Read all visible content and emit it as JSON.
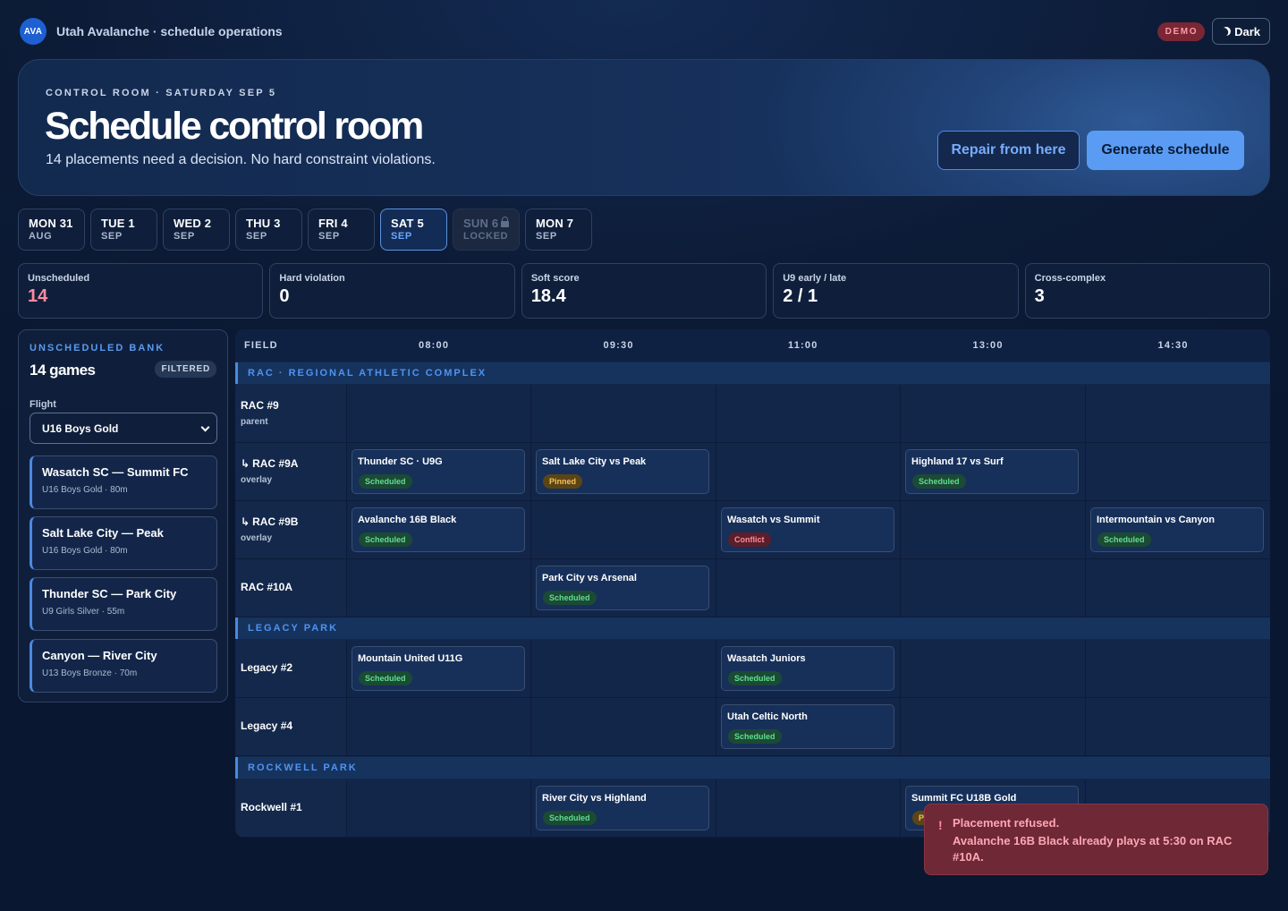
{
  "app": {
    "logo": "AVA",
    "title": "Utah Avalanche · schedule operations",
    "demo_badge": "DEMO",
    "theme_label": "Dark"
  },
  "hero": {
    "eyebrow": "CONTROL ROOM · SATURDAY SEP 5",
    "title": "Schedule control room",
    "subtitle": "14 placements need a decision. No hard constraint violations.",
    "repair_label": "Repair from here",
    "generate_label": "Generate schedule"
  },
  "days": [
    {
      "day": "MON 31",
      "month": "AUG",
      "state": "normal"
    },
    {
      "day": "TUE 1",
      "month": "SEP",
      "state": "normal"
    },
    {
      "day": "WED 2",
      "month": "SEP",
      "state": "normal"
    },
    {
      "day": "THU 3",
      "month": "SEP",
      "state": "normal"
    },
    {
      "day": "FRI 4",
      "month": "SEP",
      "state": "normal"
    },
    {
      "day": "SAT 5",
      "month": "SEP",
      "state": "active"
    },
    {
      "day": "SUN 6",
      "month": "LOCKED",
      "state": "locked"
    },
    {
      "day": "MON 7",
      "month": "SEP",
      "state": "normal"
    }
  ],
  "stats": [
    {
      "label": "Unscheduled",
      "value": "14",
      "accent": "#ff8aa0"
    },
    {
      "label": "Hard violation",
      "value": "0"
    },
    {
      "label": "Soft score",
      "value": "18.4"
    },
    {
      "label": "U9 early / late",
      "value": "2 / 1"
    },
    {
      "label": "Cross-complex",
      "value": "3"
    }
  ],
  "bank": {
    "eyebrow": "UNSCHEDULED BANK",
    "count": "14 games",
    "filter_badge": "FILTERED",
    "flight_label": "Flight",
    "flight_value": "U16 Boys Gold",
    "cards": [
      {
        "title": "Wasatch SC — Summit FC",
        "meta": "U16 Boys Gold · 80m"
      },
      {
        "title": "Salt Lake City — Peak",
        "meta": "U16 Boys Gold · 80m"
      },
      {
        "title": "Thunder SC — Park City",
        "meta": "U9 Girls Silver · 55m"
      },
      {
        "title": "Canyon — River City",
        "meta": "U13 Boys Bronze · 70m"
      }
    ]
  },
  "grid": {
    "field_header": "FIELD",
    "times": [
      "08:00",
      "09:30",
      "11:00",
      "13:00",
      "14:30"
    ],
    "sections": [
      {
        "name": "RAC · REGIONAL ATHLETIC COMPLEX"
      },
      {
        "name": "LEGACY PARK"
      },
      {
        "name": "ROCKWELL PARK"
      }
    ],
    "rows": [
      {
        "name": "RAC #9",
        "sub": "parent"
      },
      {
        "name": "RAC #9A",
        "sub": "overlay",
        "prefix": "↳"
      },
      {
        "name": "RAC #9B",
        "sub": "overlay",
        "prefix": "↳"
      },
      {
        "name": "RAC #10A",
        "sub": ""
      },
      {
        "name": "Legacy #2",
        "sub": ""
      },
      {
        "name": "Legacy #4",
        "sub": ""
      },
      {
        "name": "Rockwell #1",
        "sub": ""
      }
    ],
    "games": [
      {
        "row": 1,
        "slot": 0,
        "title": "Thunder SC · U9G",
        "status": "Scheduled",
        "kind": "ok"
      },
      {
        "row": 1,
        "slot": 1,
        "title": "Salt Lake City vs Peak",
        "status": "Pinned",
        "kind": "pin"
      },
      {
        "row": 1,
        "slot": 3,
        "title": "Highland 17 vs Surf",
        "status": "Scheduled",
        "kind": "ok"
      },
      {
        "row": 2,
        "slot": 0,
        "title": "Avalanche 16B Black",
        "status": "Scheduled",
        "kind": "ok"
      },
      {
        "row": 2,
        "slot": 2,
        "title": "Wasatch vs Summit",
        "status": "Conflict",
        "kind": "bad"
      },
      {
        "row": 2,
        "slot": 4,
        "title": "Intermountain vs Canyon",
        "status": "Scheduled",
        "kind": "ok"
      },
      {
        "row": 3,
        "slot": 1,
        "title": "Park City vs Arsenal",
        "status": "Scheduled",
        "kind": "ok"
      },
      {
        "row": 4,
        "slot": 0,
        "title": "Mountain United U11G",
        "status": "Scheduled",
        "kind": "ok"
      },
      {
        "row": 4,
        "slot": 2,
        "title": "Wasatch Juniors",
        "status": "Scheduled",
        "kind": "ok"
      },
      {
        "row": 5,
        "slot": 2,
        "title": "Utah Celtic North",
        "status": "Scheduled",
        "kind": "ok"
      },
      {
        "row": 6,
        "slot": 1,
        "title": "River City vs Highland",
        "status": "Scheduled",
        "kind": "ok"
      },
      {
        "row": 6,
        "slot": 3,
        "title": "Summit FC U18B Gold",
        "status": "P",
        "kind": "pin"
      }
    ]
  },
  "toast": {
    "icon": "!",
    "title": "Placement refused.",
    "message": "Avalanche 16B Black already plays at 5:30 on RAC #10A."
  }
}
